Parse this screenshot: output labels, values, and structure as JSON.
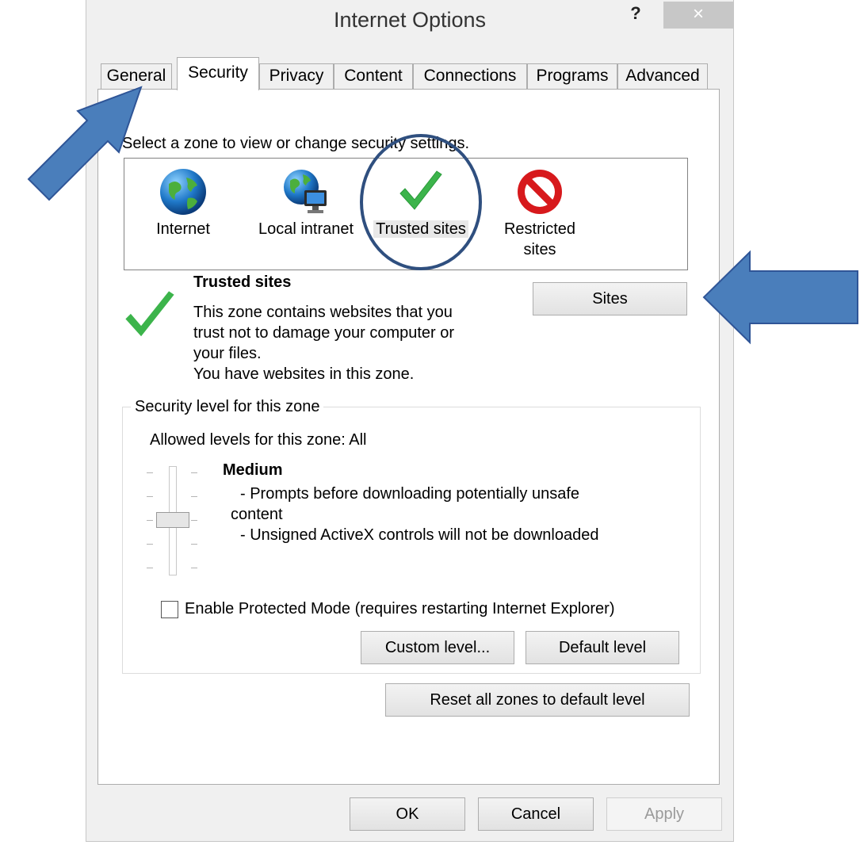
{
  "window": {
    "title": "Internet Options",
    "help_label": "?",
    "close_label": "×"
  },
  "tabs": [
    {
      "label": "General"
    },
    {
      "label": "Security"
    },
    {
      "label": "Privacy"
    },
    {
      "label": "Content"
    },
    {
      "label": "Connections"
    },
    {
      "label": "Programs"
    },
    {
      "label": "Advanced"
    }
  ],
  "active_tab": "Security",
  "security": {
    "zone_prompt": "Select a zone to view or change security settings.",
    "zones": [
      {
        "label": "Internet",
        "icon": "globe-icon"
      },
      {
        "label": "Local intranet",
        "icon": "intranet-globe-icon"
      },
      {
        "label": "Trusted sites",
        "icon": "checkmark-icon"
      },
      {
        "label_line1": "Restricted",
        "label_line2": "sites",
        "icon": "no-entry-icon"
      }
    ],
    "selected_zone": "Trusted sites",
    "description": {
      "title": "Trusted sites",
      "lines": [
        "This zone contains websites that you",
        "trust not to damage your computer or",
        "your files.",
        "You have websites in this zone."
      ]
    },
    "sites_button": "Sites",
    "level_group": {
      "legend": "Security level for this zone",
      "allowed": "Allowed levels for this zone: All",
      "level_name": "Medium",
      "level_lines": [
        "- Prompts before downloading potentially unsafe",
        "content",
        "- Unsigned ActiveX controls will not be downloaded"
      ],
      "protected_mode_label": "Enable Protected Mode (requires restarting Internet Explorer)",
      "protected_mode_checked": false,
      "custom_level_button": "Custom level...",
      "default_level_button": "Default level"
    },
    "reset_button": "Reset all zones to default level"
  },
  "footer": {
    "ok": "OK",
    "cancel": "Cancel",
    "apply": "Apply"
  },
  "colors": {
    "arrow": "#4a7ebb",
    "arrow_border": "#2f5597",
    "circle": "#2f4f7f",
    "check_green": "#3cb44b",
    "stop_red": "#d7191c"
  }
}
